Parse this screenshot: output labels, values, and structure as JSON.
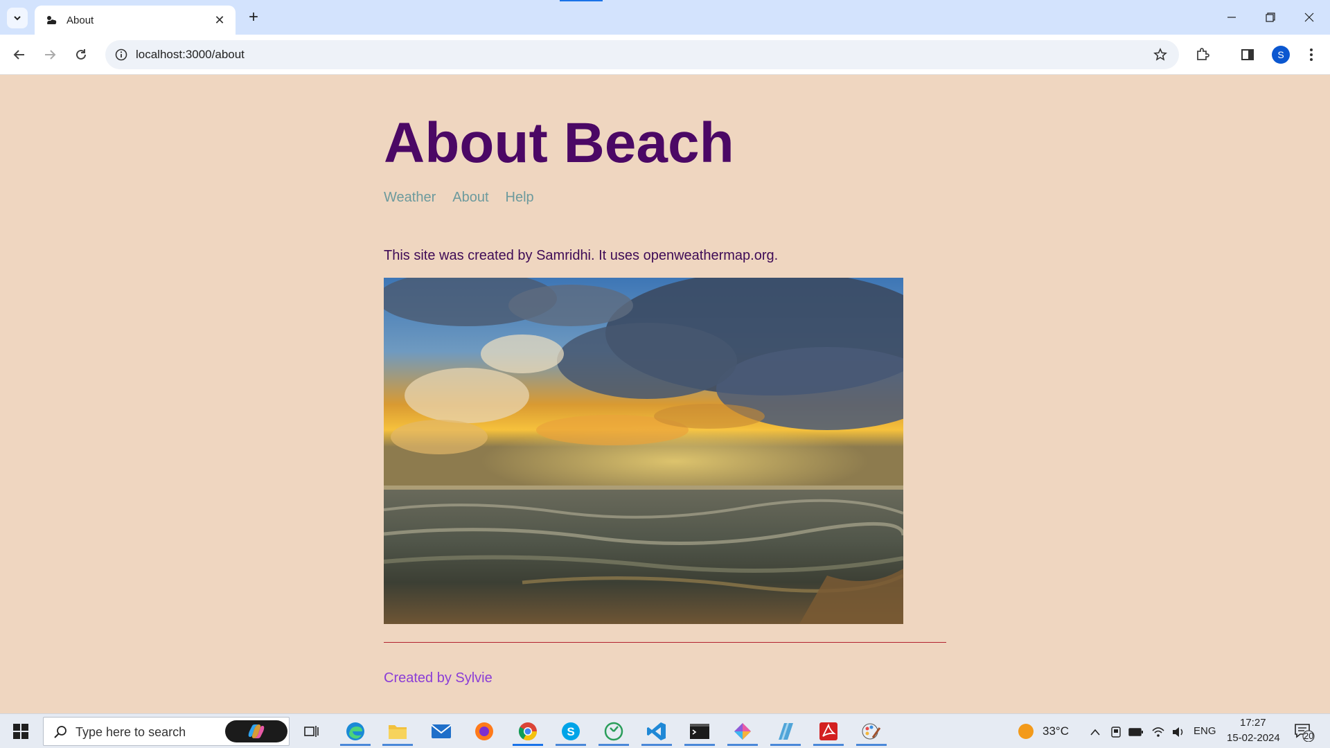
{
  "browser": {
    "tab": {
      "title": "About"
    },
    "address": {
      "url": "localhost:3000/about"
    },
    "profile_initial": "S"
  },
  "page": {
    "title": "About Beach",
    "nav": [
      {
        "label": "Weather"
      },
      {
        "label": "About"
      },
      {
        "label": "Help"
      }
    ],
    "intro_text": "This site was created by Samridhi. It uses openweathermap.org.",
    "footer_text": "Created by Sylvie"
  },
  "taskbar": {
    "search_placeholder": "Type here to search",
    "weather_temp": "33°C",
    "language": "ENG",
    "time": "17:27",
    "date": "15-02-2024",
    "notification_count": "20"
  },
  "colors": {
    "page_background": "#efd6c0",
    "title": "#4b0865",
    "nav_link": "#6c9a9d",
    "body_text": "#3e0b56",
    "divider": "#b2202f",
    "footer_text": "#8a3dd6"
  }
}
